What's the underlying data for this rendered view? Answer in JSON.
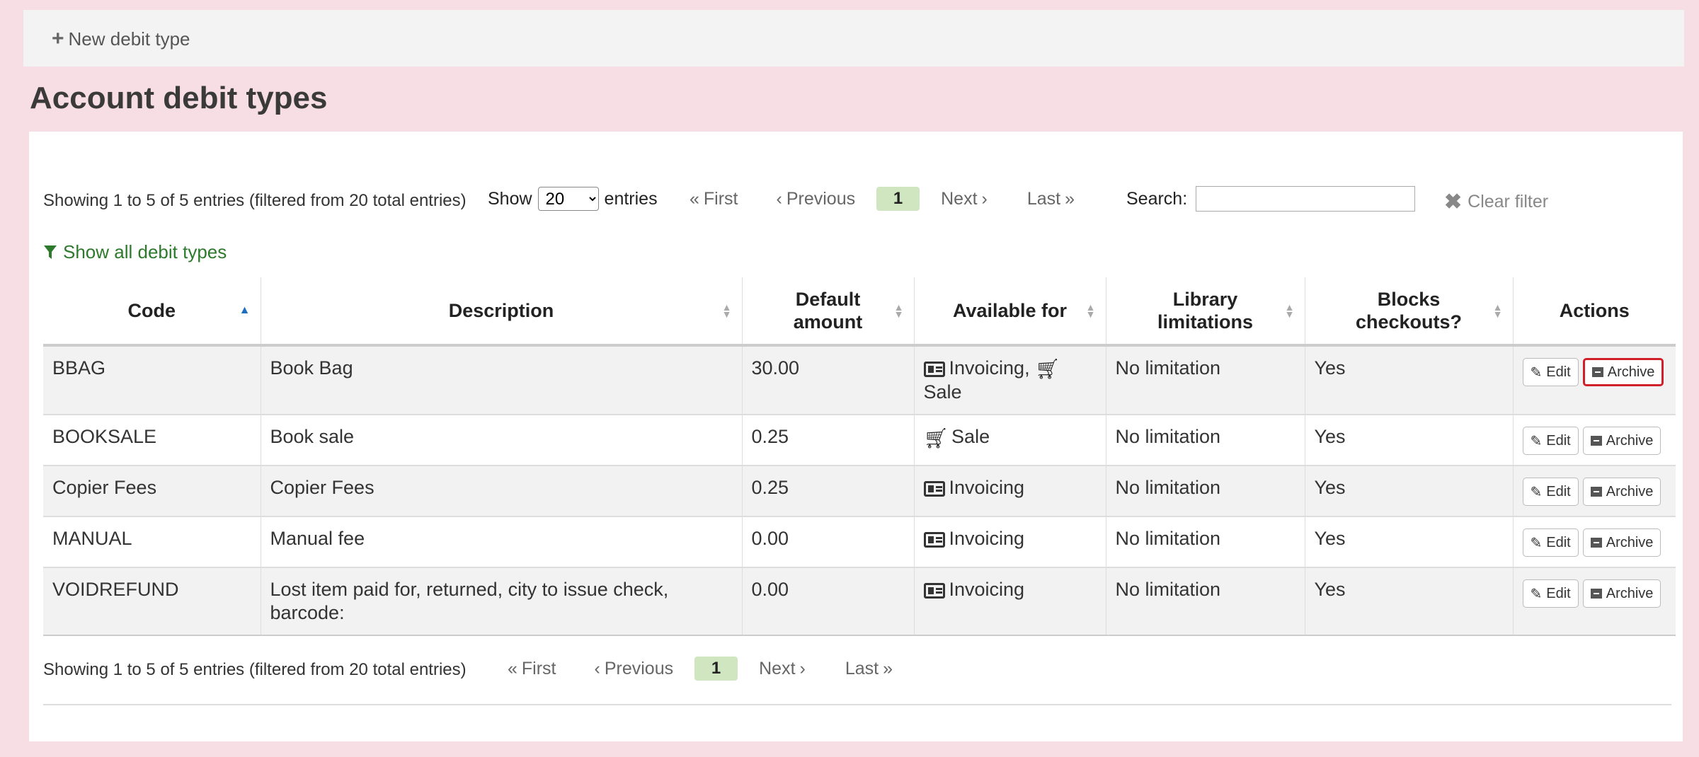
{
  "toolbar": {
    "new_label": "New debit type",
    "icon": "plus-icon"
  },
  "page": {
    "title": "Account debit types"
  },
  "top": {
    "info": "Showing 1 to 5 of 5 entries (filtered from 20 total entries)",
    "show_label": "Show",
    "show_value": "20",
    "entries_label": "entries",
    "search_label": "Search:",
    "search_value": "",
    "clear_filter": "Clear filter",
    "show_all": "Show all debit types"
  },
  "pager": {
    "first": "First",
    "previous": "Previous",
    "current": "1",
    "next": "Next",
    "last": "Last"
  },
  "table": {
    "headers": {
      "code": "Code",
      "description": "Description",
      "default_amount_1": "Default",
      "default_amount_2": "amount",
      "available_for": "Available for",
      "library_1": "Library",
      "library_2": "limitations",
      "blocks_1": "Blocks",
      "blocks_2": "checkouts?",
      "actions": "Actions"
    },
    "rows": [
      {
        "code": "BBAG",
        "description": "Book Bag",
        "amount": "30.00",
        "invoicing": "Invoicing,",
        "sale": "Sale",
        "library": "No limitation",
        "blocks": "Yes"
      },
      {
        "code": "BOOKSALE",
        "description": "Book sale",
        "amount": "0.25",
        "sale": "Sale",
        "library": "No limitation",
        "blocks": "Yes"
      },
      {
        "code": "Copier Fees",
        "description": "Copier Fees",
        "amount": "0.25",
        "invoicing": "Invoicing",
        "library": "No limitation",
        "blocks": "Yes"
      },
      {
        "code": "MANUAL",
        "description": "Manual fee",
        "amount": "0.00",
        "invoicing": "Invoicing",
        "library": "No limitation",
        "blocks": "Yes"
      },
      {
        "code": "VOIDREFUND",
        "description": "Lost item paid for, returned, city to issue check, barcode:",
        "amount": "0.00",
        "invoicing": "Invoicing",
        "library": "No limitation",
        "blocks": "Yes"
      }
    ],
    "edit_label": "Edit",
    "archive_label": "Archive"
  },
  "bottom": {
    "info": "Showing 1 to 5 of 5 entries (filtered from 20 total entries)"
  },
  "colors": {
    "background": "#f7dde4",
    "current_page": "#cfe6c0",
    "filter_link": "#2d7a2d",
    "highlight": "#d0202a"
  }
}
